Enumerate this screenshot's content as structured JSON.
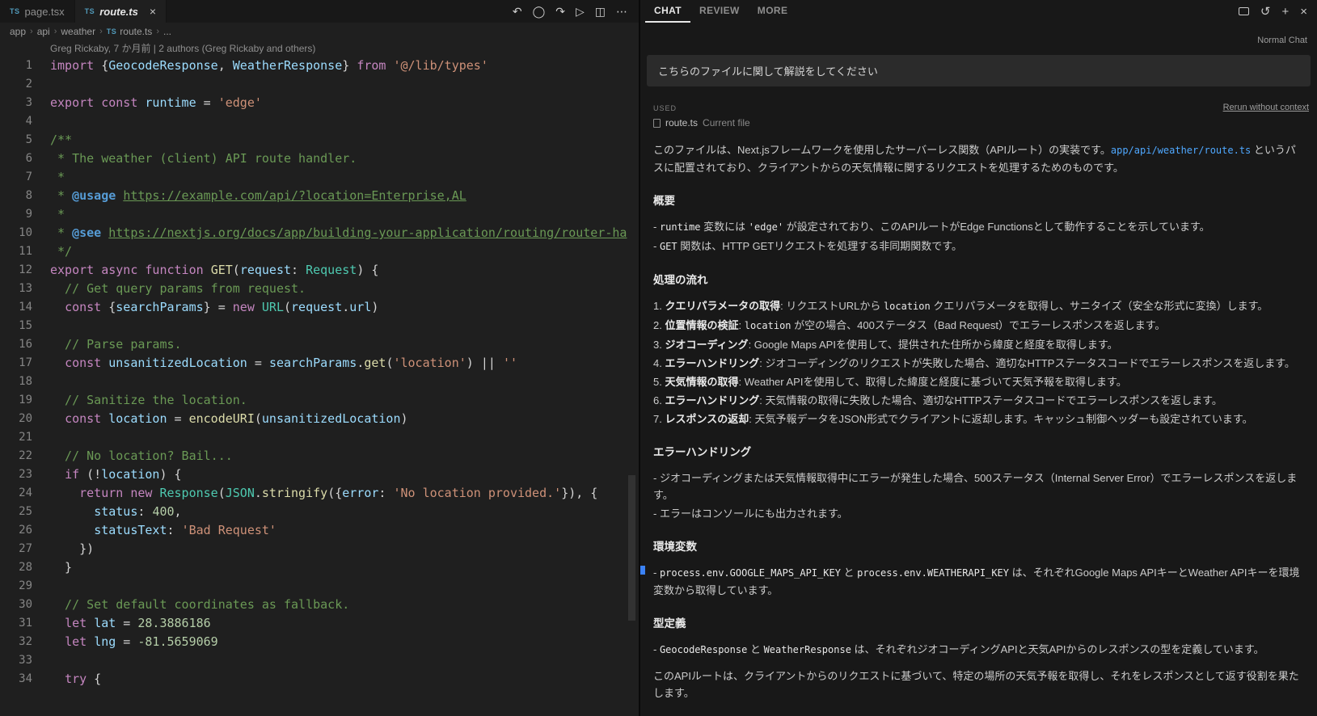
{
  "colors": {
    "accent_blue": "#4fa8ff",
    "ts_blue": "#519aba",
    "marker_blue": "#3b82f6"
  },
  "editor": {
    "tabs": [
      {
        "label": "page.tsx",
        "icon": "TS",
        "active": false,
        "closable": false
      },
      {
        "label": "route.ts",
        "icon": "TS",
        "active": true,
        "closable": true,
        "close_glyph": "×"
      }
    ],
    "actions": [
      {
        "name": "nav-back-icon",
        "glyph": "↶"
      },
      {
        "name": "timeline-icon",
        "glyph": "◯"
      },
      {
        "name": "nav-forward-icon",
        "glyph": "↷"
      },
      {
        "name": "run-file-icon",
        "glyph": "▷"
      },
      {
        "name": "split-editor-icon",
        "glyph": "◫"
      },
      {
        "name": "more-actions-icon",
        "glyph": "⋯"
      }
    ],
    "breadcrumb_separator": "›",
    "ts_icon": "TS",
    "breadcrumb": [
      {
        "label": "app"
      },
      {
        "label": "api"
      },
      {
        "label": "weather"
      },
      {
        "label": "route.ts",
        "ts": true
      },
      {
        "label": "..."
      }
    ],
    "codelens": "Greg Rickaby, 7 か月前 | 2 authors (Greg Rickaby and others)",
    "code_lines": [
      {
        "n": 1,
        "toks": [
          [
            "kw",
            "import"
          ],
          [
            "pl",
            " {"
          ],
          [
            "vr",
            "GeocodeResponse"
          ],
          [
            "pl",
            ", "
          ],
          [
            "vr",
            "WeatherResponse"
          ],
          [
            "pl",
            "} "
          ],
          [
            "kw",
            "from"
          ],
          [
            "pl",
            " "
          ],
          [
            "st",
            "'@/lib/types'"
          ]
        ]
      },
      {
        "n": 2,
        "toks": []
      },
      {
        "n": 3,
        "toks": [
          [
            "kw",
            "export"
          ],
          [
            "pl",
            " "
          ],
          [
            "kw",
            "const"
          ],
          [
            "pl",
            " "
          ],
          [
            "vr",
            "runtime"
          ],
          [
            "pl",
            " = "
          ],
          [
            "st",
            "'edge'"
          ]
        ]
      },
      {
        "n": 4,
        "toks": []
      },
      {
        "n": 5,
        "toks": [
          [
            "cm",
            "/**"
          ]
        ]
      },
      {
        "n": 6,
        "toks": [
          [
            "cm",
            " * The weather (client) API route handler."
          ]
        ]
      },
      {
        "n": 7,
        "toks": [
          [
            "cm",
            " *"
          ]
        ]
      },
      {
        "n": 8,
        "toks": [
          [
            "cm",
            " * "
          ],
          [
            "tg",
            "@usage"
          ],
          [
            "cm",
            " "
          ],
          [
            "lk",
            "https://example.com/api/?location=Enterprise,AL"
          ]
        ]
      },
      {
        "n": 9,
        "toks": [
          [
            "cm",
            " *"
          ]
        ]
      },
      {
        "n": 10,
        "toks": [
          [
            "cm",
            " * "
          ],
          [
            "tg",
            "@see"
          ],
          [
            "cm",
            " "
          ],
          [
            "lk",
            "https://nextjs.org/docs/app/building-your-application/routing/router-ha"
          ]
        ]
      },
      {
        "n": 11,
        "toks": [
          [
            "cm",
            " */"
          ]
        ]
      },
      {
        "n": 12,
        "toks": [
          [
            "kw",
            "export"
          ],
          [
            "pl",
            " "
          ],
          [
            "kw",
            "async"
          ],
          [
            "pl",
            " "
          ],
          [
            "kw",
            "function"
          ],
          [
            "pl",
            " "
          ],
          [
            "fn",
            "GET"
          ],
          [
            "pl",
            "("
          ],
          [
            "vr",
            "request"
          ],
          [
            "pl",
            ": "
          ],
          [
            "ty",
            "Request"
          ],
          [
            "pl",
            ") {"
          ]
        ]
      },
      {
        "n": 13,
        "toks": [
          [
            "cm",
            "  // Get query params from request."
          ]
        ]
      },
      {
        "n": 14,
        "toks": [
          [
            "pl",
            "  "
          ],
          [
            "kw",
            "const"
          ],
          [
            "pl",
            " {"
          ],
          [
            "vr",
            "searchParams"
          ],
          [
            "pl",
            "} = "
          ],
          [
            "kw",
            "new"
          ],
          [
            "pl",
            " "
          ],
          [
            "ty",
            "URL"
          ],
          [
            "pl",
            "("
          ],
          [
            "vr",
            "request"
          ],
          [
            "pl",
            "."
          ],
          [
            "vr",
            "url"
          ],
          [
            "pl",
            ")"
          ]
        ]
      },
      {
        "n": 15,
        "toks": []
      },
      {
        "n": 16,
        "toks": [
          [
            "cm",
            "  // Parse params."
          ]
        ]
      },
      {
        "n": 17,
        "toks": [
          [
            "pl",
            "  "
          ],
          [
            "kw",
            "const"
          ],
          [
            "pl",
            " "
          ],
          [
            "vr",
            "unsanitizedLocation"
          ],
          [
            "pl",
            " = "
          ],
          [
            "vr",
            "searchParams"
          ],
          [
            "pl",
            "."
          ],
          [
            "fn",
            "get"
          ],
          [
            "pl",
            "("
          ],
          [
            "st",
            "'location'"
          ],
          [
            "pl",
            ") || "
          ],
          [
            "st",
            "''"
          ]
        ]
      },
      {
        "n": 18,
        "toks": []
      },
      {
        "n": 19,
        "toks": [
          [
            "cm",
            "  // Sanitize the location."
          ]
        ]
      },
      {
        "n": 20,
        "toks": [
          [
            "pl",
            "  "
          ],
          [
            "kw",
            "const"
          ],
          [
            "pl",
            " "
          ],
          [
            "vr",
            "location"
          ],
          [
            "pl",
            " = "
          ],
          [
            "fn",
            "encodeURI"
          ],
          [
            "pl",
            "("
          ],
          [
            "vr",
            "unsanitizedLocation"
          ],
          [
            "pl",
            ")"
          ]
        ]
      },
      {
        "n": 21,
        "toks": []
      },
      {
        "n": 22,
        "toks": [
          [
            "cm",
            "  // No location? Bail..."
          ]
        ]
      },
      {
        "n": 23,
        "toks": [
          [
            "pl",
            "  "
          ],
          [
            "kw",
            "if"
          ],
          [
            "pl",
            " (!"
          ],
          [
            "vr",
            "location"
          ],
          [
            "pl",
            ") {"
          ]
        ]
      },
      {
        "n": 24,
        "toks": [
          [
            "pl",
            "    "
          ],
          [
            "kw",
            "return"
          ],
          [
            "pl",
            " "
          ],
          [
            "kw",
            "new"
          ],
          [
            "pl",
            " "
          ],
          [
            "ty",
            "Response"
          ],
          [
            "pl",
            "("
          ],
          [
            "ty",
            "JSON"
          ],
          [
            "pl",
            "."
          ],
          [
            "fn",
            "stringify"
          ],
          [
            "pl",
            "({"
          ],
          [
            "vr",
            "error"
          ],
          [
            "pl",
            ": "
          ],
          [
            "st",
            "'No location provided.'"
          ],
          [
            "pl",
            "}), {"
          ]
        ]
      },
      {
        "n": 25,
        "toks": [
          [
            "pl",
            "      "
          ],
          [
            "vr",
            "status"
          ],
          [
            "pl",
            ": "
          ],
          [
            "nm",
            "400"
          ],
          [
            "pl",
            ","
          ]
        ]
      },
      {
        "n": 26,
        "toks": [
          [
            "pl",
            "      "
          ],
          [
            "vr",
            "statusText"
          ],
          [
            "pl",
            ": "
          ],
          [
            "st",
            "'Bad Request'"
          ]
        ]
      },
      {
        "n": 27,
        "toks": [
          [
            "pl",
            "    })"
          ]
        ]
      },
      {
        "n": 28,
        "toks": [
          [
            "pl",
            "  }"
          ]
        ]
      },
      {
        "n": 29,
        "toks": []
      },
      {
        "n": 30,
        "toks": [
          [
            "cm",
            "  // Set default coordinates as fallback."
          ]
        ]
      },
      {
        "n": 31,
        "toks": [
          [
            "pl",
            "  "
          ],
          [
            "kw",
            "let"
          ],
          [
            "pl",
            " "
          ],
          [
            "vr",
            "lat"
          ],
          [
            "pl",
            " = "
          ],
          [
            "nm",
            "28.3886186"
          ]
        ]
      },
      {
        "n": 32,
        "toks": [
          [
            "pl",
            "  "
          ],
          [
            "kw",
            "let"
          ],
          [
            "pl",
            " "
          ],
          [
            "vr",
            "lng"
          ],
          [
            "pl",
            " = "
          ],
          [
            "nm",
            "-81.5659069"
          ]
        ]
      },
      {
        "n": 33,
        "toks": []
      },
      {
        "n": 34,
        "toks": [
          [
            "pl",
            "  "
          ],
          [
            "kw",
            "try"
          ],
          [
            "pl",
            " {"
          ]
        ]
      }
    ]
  },
  "chat": {
    "tabs": [
      {
        "label": "CHAT",
        "active": true
      },
      {
        "label": "REVIEW",
        "active": false
      },
      {
        "label": "MORE",
        "active": false
      }
    ],
    "header_icons": [
      {
        "name": "open-in-window-icon",
        "shape": "screen"
      },
      {
        "name": "history-icon",
        "glyph": "↺"
      },
      {
        "name": "new-chat-icon",
        "glyph": "+"
      },
      {
        "name": "close-panel-icon",
        "glyph": "×"
      }
    ],
    "mode_label": "Normal Chat",
    "user_message": "こちらのファイルに関して解説をしてください",
    "used_label": "USED",
    "rerun_label": "Rerun without context",
    "context_file": {
      "name": "route.ts",
      "desc": "Current file"
    },
    "blocks": [
      {
        "type": "p",
        "segs": [
          [
            "t",
            "このファイルは、Next.jsフレームワークを使用したサーバーレス関数（APIルート）の実装です。"
          ],
          [
            "cb",
            "app/api/weather/route.ts"
          ],
          [
            "t",
            " というパスに配置されており、クライアントからの天気情報に関するリクエストを処理するためのものです。"
          ]
        ]
      },
      {
        "type": "h",
        "segs": [
          [
            "t",
            "概要"
          ]
        ]
      },
      {
        "type": "li",
        "segs": [
          [
            "t",
            "- "
          ],
          [
            "c",
            "runtime"
          ],
          [
            "t",
            " 変数には "
          ],
          [
            "c",
            "'edge'"
          ],
          [
            "t",
            " が設定されており、このAPIルートがEdge Functionsとして動作することを示しています。"
          ]
        ]
      },
      {
        "type": "li",
        "segs": [
          [
            "t",
            "- "
          ],
          [
            "c",
            "GET"
          ],
          [
            "t",
            " 関数は、HTTP GETリクエストを処理する非同期関数です。"
          ]
        ]
      },
      {
        "type": "h",
        "segs": [
          [
            "t",
            "処理の流れ"
          ]
        ]
      },
      {
        "type": "li",
        "segs": [
          [
            "t",
            "1. "
          ],
          [
            "b",
            "クエリパラメータの取得"
          ],
          [
            "t",
            ": リクエストURLから "
          ],
          [
            "c",
            "location"
          ],
          [
            "t",
            " クエリパラメータを取得し、サニタイズ（安全な形式に変換）します。"
          ]
        ]
      },
      {
        "type": "li",
        "segs": [
          [
            "t",
            "2. "
          ],
          [
            "b",
            "位置情報の検証"
          ],
          [
            "t",
            ": "
          ],
          [
            "c",
            "location"
          ],
          [
            "t",
            " が空の場合、400ステータス（Bad Request）でエラーレスポンスを返します。"
          ]
        ]
      },
      {
        "type": "li",
        "segs": [
          [
            "t",
            "3. "
          ],
          [
            "b",
            "ジオコーディング"
          ],
          [
            "t",
            ": Google Maps APIを使用して、提供された住所から緯度と経度を取得します。"
          ]
        ]
      },
      {
        "type": "li",
        "segs": [
          [
            "t",
            "4. "
          ],
          [
            "b",
            "エラーハンドリング"
          ],
          [
            "t",
            ": ジオコーディングのリクエストが失敗した場合、適切なHTTPステータスコードでエラーレスポンスを返します。"
          ]
        ]
      },
      {
        "type": "li",
        "segs": [
          [
            "t",
            "5. "
          ],
          [
            "b",
            "天気情報の取得"
          ],
          [
            "t",
            ": Weather APIを使用して、取得した緯度と経度に基づいて天気予報を取得します。"
          ]
        ]
      },
      {
        "type": "li",
        "segs": [
          [
            "t",
            "6. "
          ],
          [
            "b",
            "エラーハンドリング"
          ],
          [
            "t",
            ": 天気情報の取得に失敗した場合、適切なHTTPステータスコードでエラーレスポンスを返します。"
          ]
        ]
      },
      {
        "type": "li",
        "segs": [
          [
            "t",
            "7. "
          ],
          [
            "b",
            "レスポンスの返却"
          ],
          [
            "t",
            ": 天気予報データをJSON形式でクライアントに返却します。キャッシュ制御ヘッダーも設定されています。"
          ]
        ]
      },
      {
        "type": "h",
        "segs": [
          [
            "t",
            "エラーハンドリング"
          ]
        ]
      },
      {
        "type": "li",
        "segs": [
          [
            "t",
            "- ジオコーディングまたは天気情報取得中にエラーが発生した場合、500ステータス（Internal Server Error）でエラーレスポンスを返します。"
          ]
        ]
      },
      {
        "type": "li",
        "segs": [
          [
            "t",
            "- エラーはコンソールにも出力されます。"
          ]
        ]
      },
      {
        "type": "h",
        "segs": [
          [
            "t",
            "環境変数"
          ]
        ]
      },
      {
        "type": "li",
        "segs": [
          [
            "t",
            "- "
          ],
          [
            "c",
            "process.env.GOOGLE_MAPS_API_KEY"
          ],
          [
            "t",
            " と "
          ],
          [
            "c",
            "process.env.WEATHERAPI_KEY"
          ],
          [
            "t",
            " は、それぞれGoogle Maps APIキーとWeather APIキーを環境変数から取得しています。"
          ]
        ]
      },
      {
        "type": "h",
        "segs": [
          [
            "t",
            "型定義"
          ]
        ]
      },
      {
        "type": "li",
        "segs": [
          [
            "t",
            "- "
          ],
          [
            "c",
            "GeocodeResponse"
          ],
          [
            "t",
            " と "
          ],
          [
            "c",
            "WeatherResponse"
          ],
          [
            "t",
            " は、それぞれジオコーディングAPIと天気APIからのレスポンスの型を定義しています。"
          ]
        ]
      },
      {
        "type": "p",
        "segs": [
          [
            "t",
            "このAPIルートは、クライアントからのリクエストに基づいて、特定の場所の天気予報を取得し、それをレスポンスとして返す役割を果たします。"
          ]
        ]
      }
    ]
  }
}
